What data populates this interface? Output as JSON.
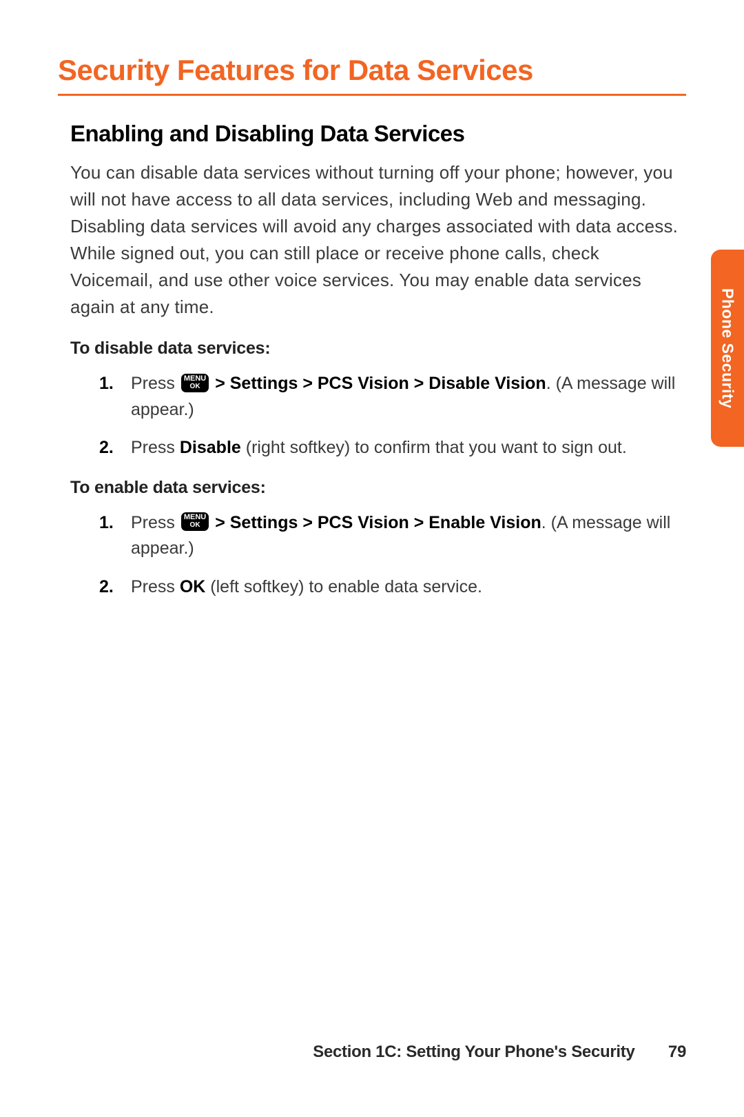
{
  "heading": "Security Features for Data Services",
  "subheading": "Enabling and Disabling Data Services",
  "intro": "You can disable data services without turning off your phone; however, you will not have access to all data services, including Web and messaging. Disabling data services will avoid any charges associated with data access. While signed out, you can still place or receive phone calls, check Voicemail, and use other voice services. You may enable data services again at any time.",
  "disable": {
    "title": "To disable data services:",
    "steps": [
      {
        "prefix": "Press ",
        "icon": {
          "top": "MENU",
          "bottom": "OK"
        },
        "bold": " > Settings > PCS Vision > Disable Vision",
        "after": ". (A message will appear.)"
      },
      {
        "prefix": "Press ",
        "bold": "Disable",
        "after": " (right softkey) to confirm that you want to sign out."
      }
    ]
  },
  "enable": {
    "title": "To enable data services:",
    "steps": [
      {
        "prefix": "Press ",
        "icon": {
          "top": "MENU",
          "bottom": "OK"
        },
        "bold": " > Settings > PCS Vision > Enable Vision",
        "after": ". (A message will appear.)"
      },
      {
        "prefix": "Press ",
        "bold": "OK",
        "after": " (left softkey) to enable data service."
      }
    ]
  },
  "tab": "Phone Security",
  "footer": {
    "section": "Section 1C: Setting Your Phone's Security",
    "page": "79"
  }
}
